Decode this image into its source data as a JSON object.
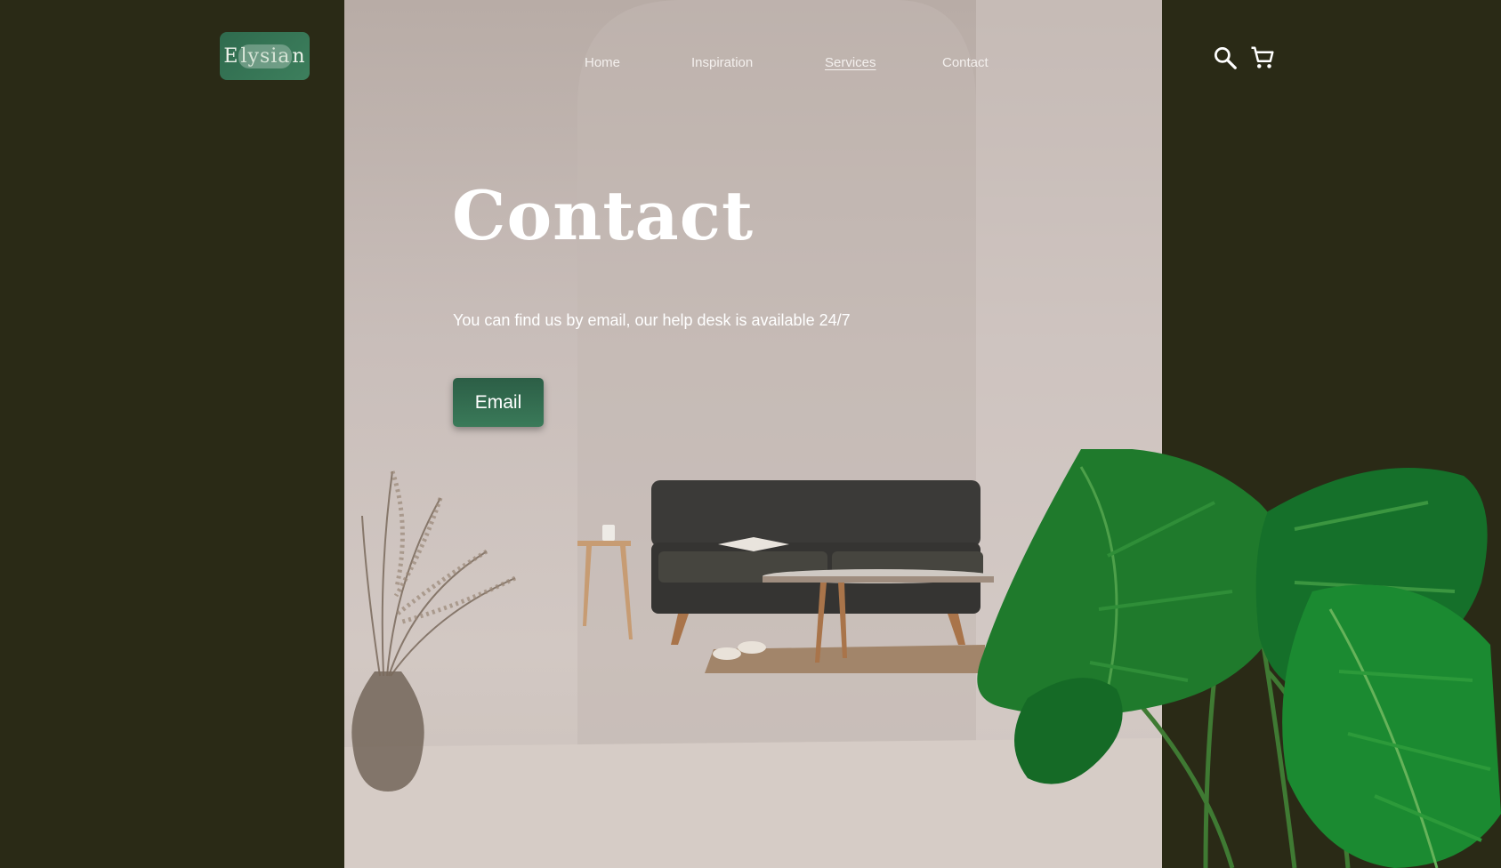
{
  "brand": {
    "logo_start": "E",
    "logo_mid": "lysia",
    "logo_end": "n"
  },
  "nav": {
    "items": [
      {
        "label": "Home",
        "active": false
      },
      {
        "label": "Inspiration",
        "active": false
      },
      {
        "label": "Services",
        "active": true
      },
      {
        "label": "Contact",
        "active": false
      }
    ]
  },
  "header_icons": {
    "search": "search-icon",
    "cart": "cart-icon"
  },
  "hero": {
    "title": "Contact",
    "subtitle": "You can find us by email, our help desk is available 24/7",
    "cta_label": "Email"
  },
  "colors": {
    "page_background": "#2a2a16",
    "accent_green": "#2f6b4e",
    "hero_wall": "#c9beba",
    "text_light": "#ffffff"
  }
}
